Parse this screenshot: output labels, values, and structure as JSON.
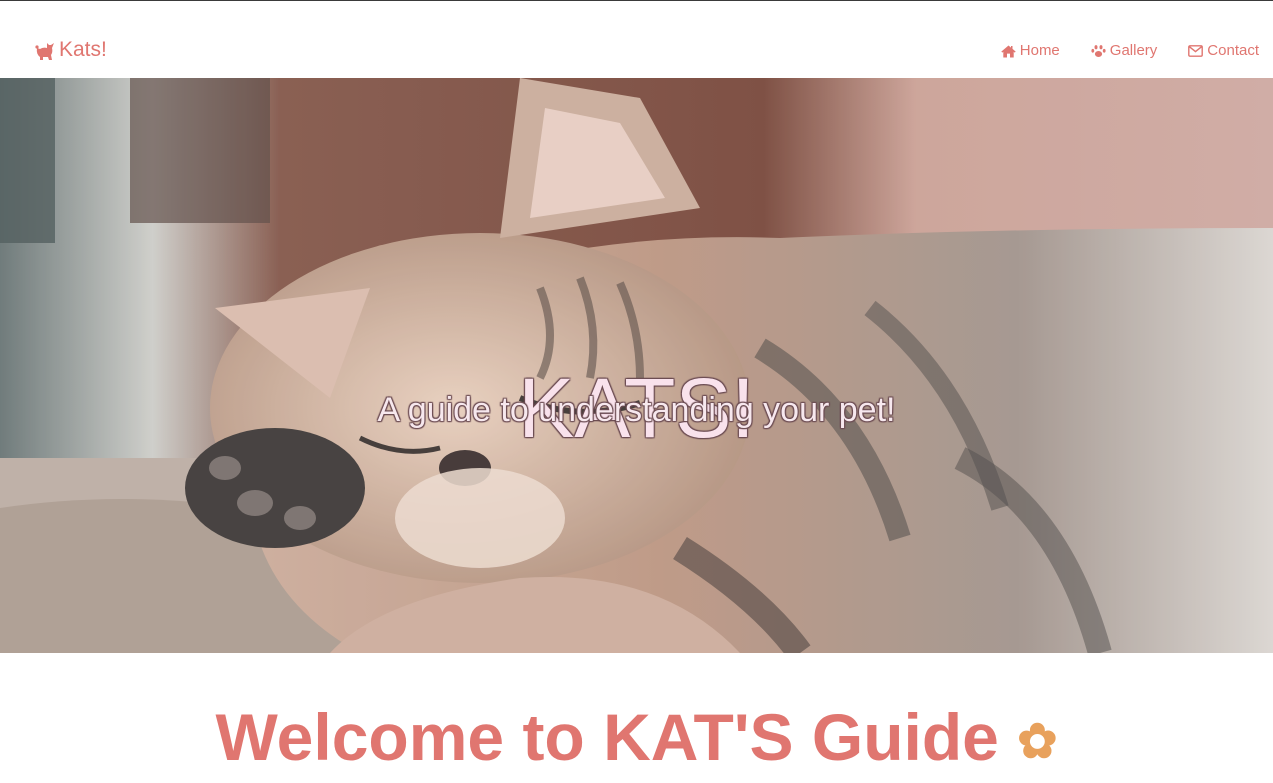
{
  "brand": {
    "label": "Kats!",
    "icon": "cat-icon",
    "color": "#e07670"
  },
  "nav": {
    "items": [
      {
        "label": "Home",
        "icon": "home-icon"
      },
      {
        "label": "Gallery",
        "icon": "paw-icon"
      },
      {
        "label": "Contact",
        "icon": "envelope-icon"
      }
    ]
  },
  "hero": {
    "title": "KATS!",
    "subtitle": "A guide to understanding your pet!",
    "image": "sleeping tabby kitten photo"
  },
  "welcome": {
    "heading": "Welcome to KAT'S Guide",
    "icon": "paw-icon",
    "icon_color": "#e8a15c"
  }
}
